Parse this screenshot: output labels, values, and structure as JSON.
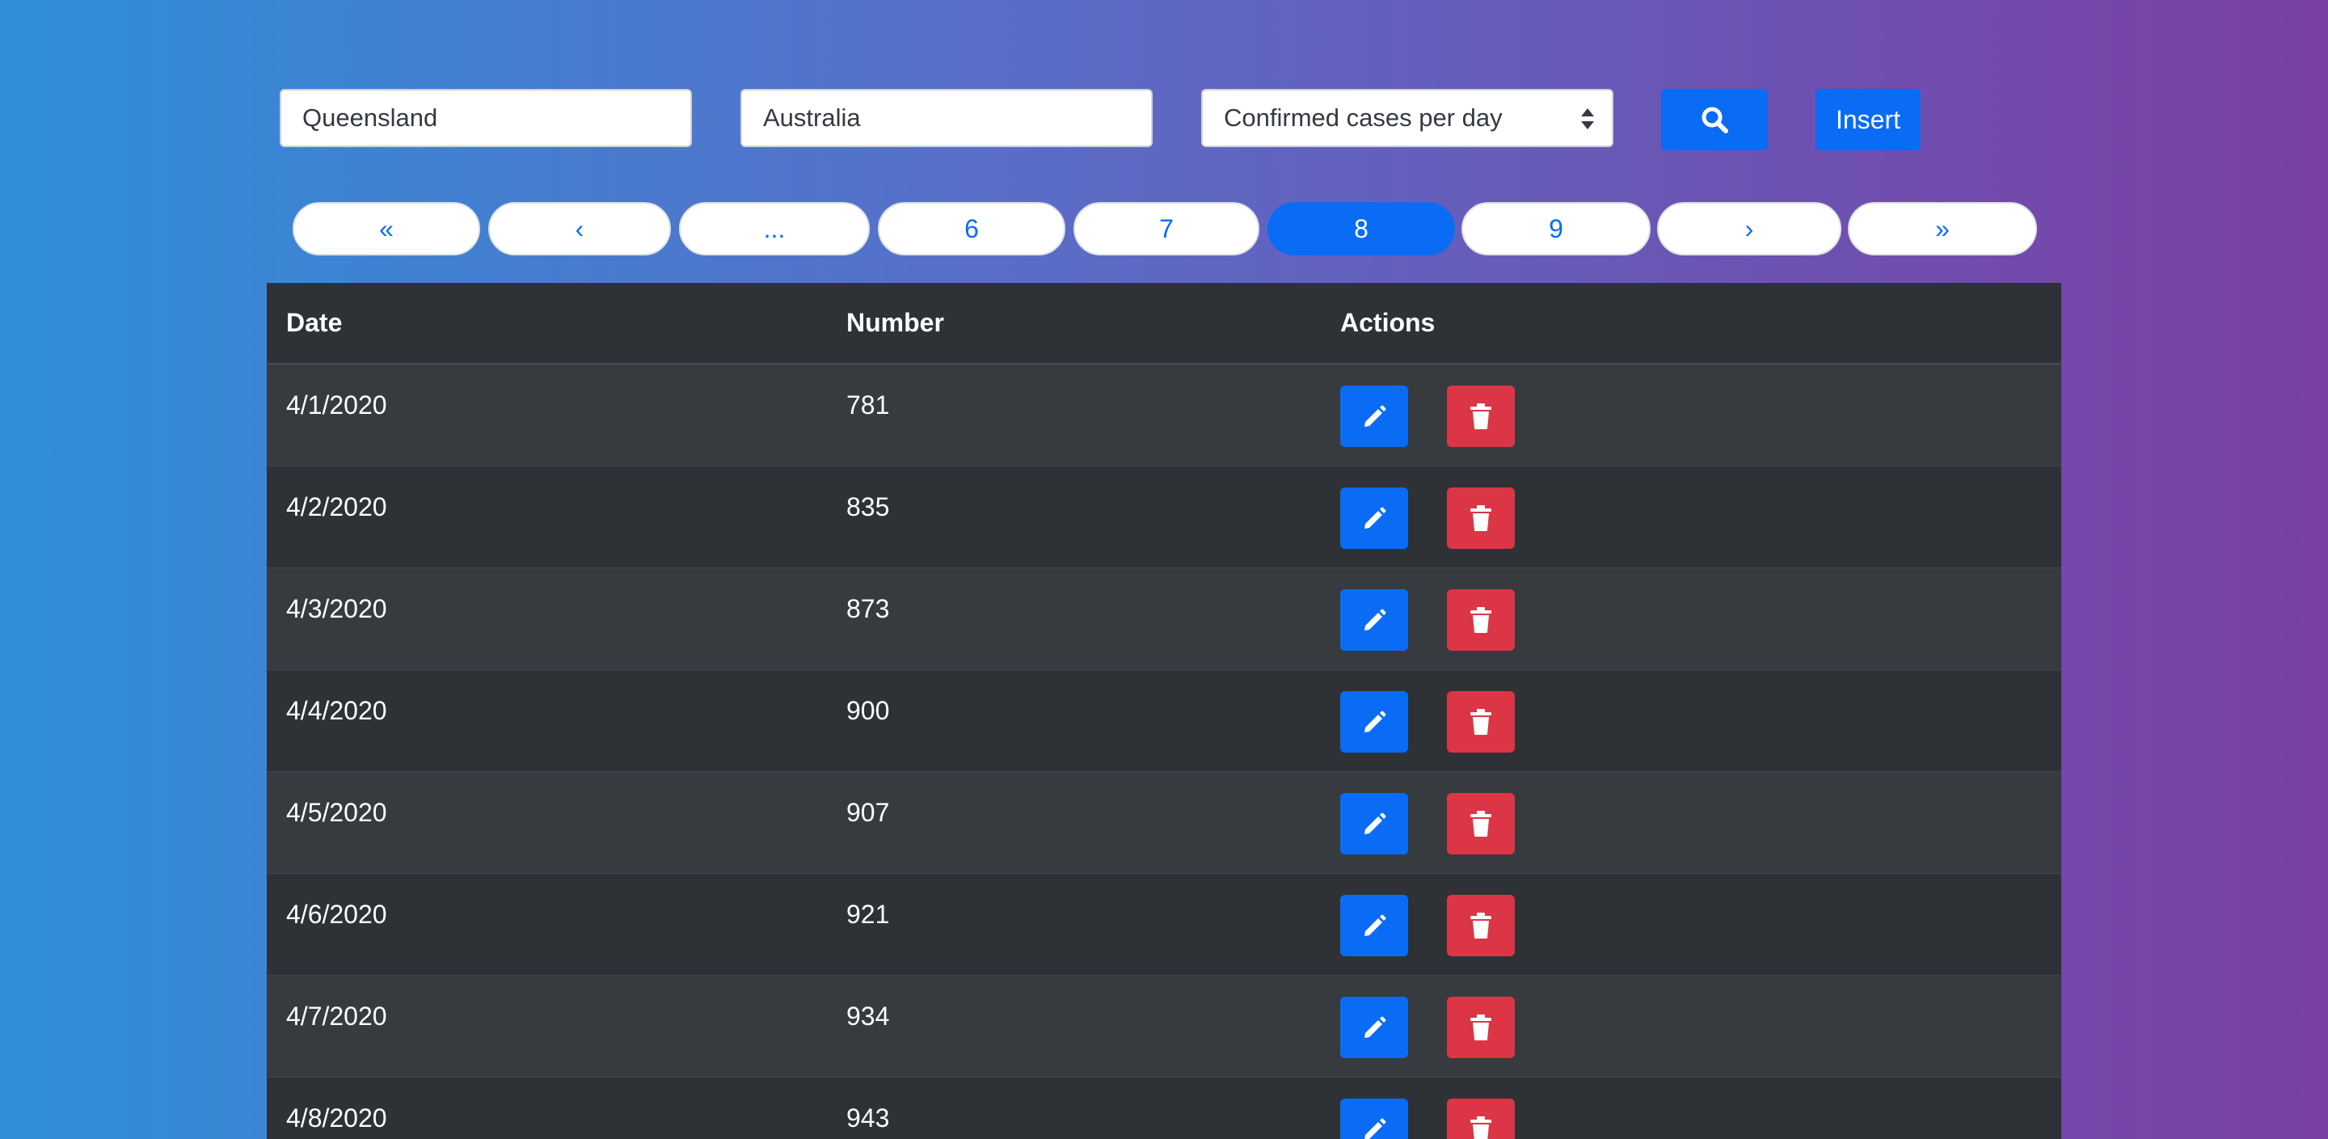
{
  "filters": {
    "state_value": "Queensland",
    "country_value": "Australia",
    "metric_selected": "Confirmed cases per day",
    "insert_label": "Insert"
  },
  "pagination": {
    "first": "«",
    "prev": "‹",
    "ellipsis": "...",
    "pages": [
      "6",
      "7",
      "8",
      "9"
    ],
    "active_page": "8",
    "next": "›",
    "last": "»"
  },
  "table": {
    "headers": {
      "date": "Date",
      "number": "Number",
      "actions": "Actions"
    },
    "rows": [
      {
        "date": "4/1/2020",
        "number": "781"
      },
      {
        "date": "4/2/2020",
        "number": "835"
      },
      {
        "date": "4/3/2020",
        "number": "873"
      },
      {
        "date": "4/4/2020",
        "number": "900"
      },
      {
        "date": "4/5/2020",
        "number": "907"
      },
      {
        "date": "4/6/2020",
        "number": "921"
      },
      {
        "date": "4/7/2020",
        "number": "934"
      },
      {
        "date": "4/8/2020",
        "number": "943"
      }
    ]
  },
  "icons": {
    "search": "search-icon",
    "edit": "pencil-icon",
    "delete": "trash-icon",
    "select_caret": "sort-caret-icon"
  },
  "colors": {
    "primary": "#0a6cf5",
    "danger": "#dc3545",
    "table_dark": "#2e3236",
    "table_stripe": "#373b40",
    "gradient_start": "#2f8fda",
    "gradient_end": "#7a3fa3"
  }
}
